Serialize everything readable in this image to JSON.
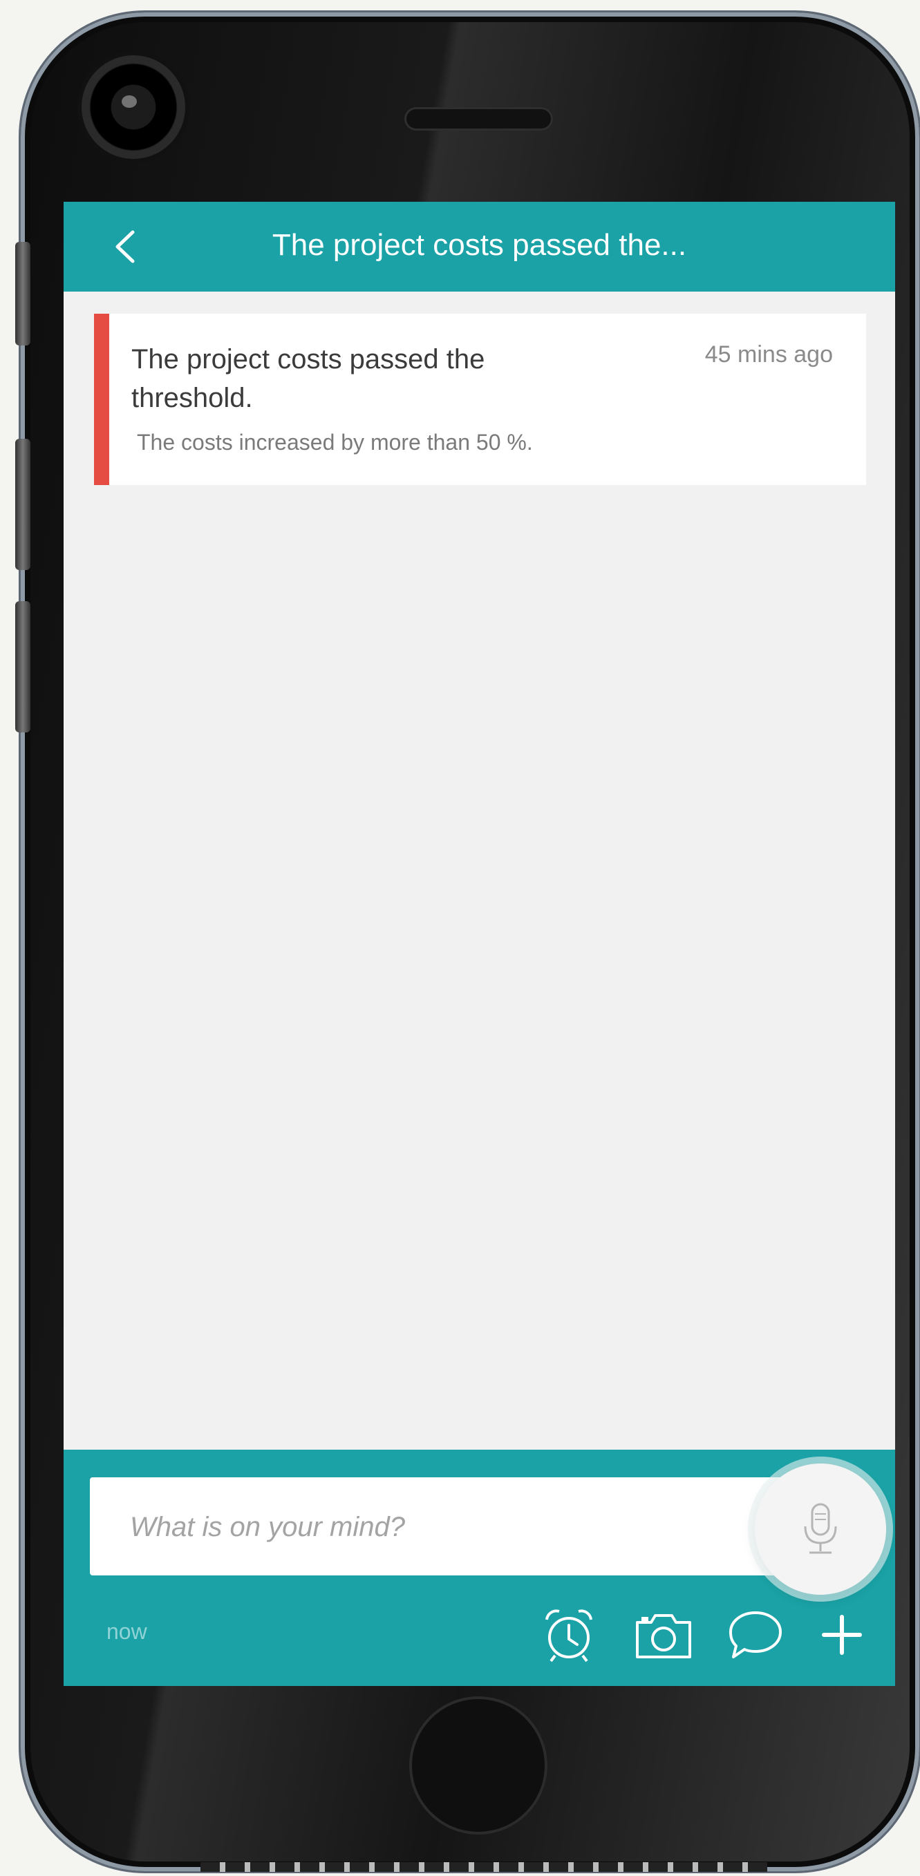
{
  "header": {
    "back_label": "‹",
    "title": "The project costs passed the..."
  },
  "alert_card": {
    "title": "The project costs passed the threshold.",
    "time": "45 mins ago",
    "description": "The costs increased by more than 50 %.",
    "severity_color": "#e64d42"
  },
  "composer": {
    "placeholder": "What is on your mind?",
    "timestamp": "now",
    "tools": [
      "alarm-clock-icon",
      "camera-icon",
      "chat-bubble-icon",
      "plus-icon"
    ]
  },
  "colors": {
    "accent": "#1aa2a6",
    "background": "#f1f1f1",
    "alert": "#e64d42"
  }
}
